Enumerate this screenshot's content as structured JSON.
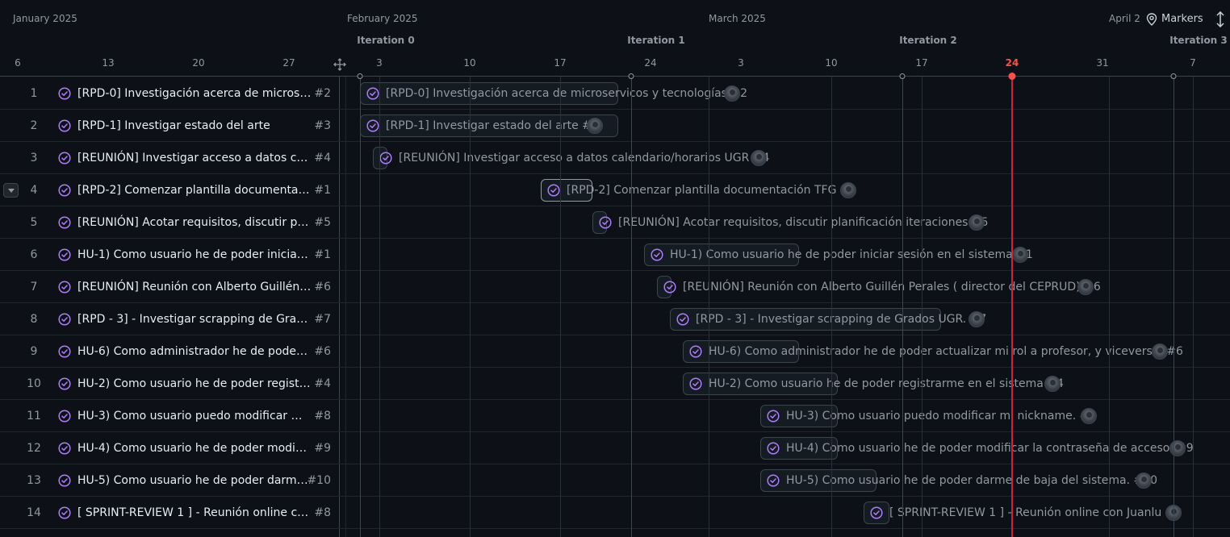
{
  "header": {
    "months": [
      "January 2025",
      "February 2025",
      "March 2025",
      "April 2"
    ],
    "iterations": [
      "Iteration 0",
      "Iteration 1",
      "Iteration 2",
      "Iteration 3"
    ],
    "days": [
      "6",
      "13",
      "20",
      "27",
      "3",
      "10",
      "17",
      "24",
      "3",
      "10",
      "17",
      "24",
      "31",
      "7"
    ],
    "today_label": "24",
    "markers_label": "Markers"
  },
  "colors": {
    "accent": "#ab7df8",
    "today": "#f85149",
    "background": "#0d1117"
  },
  "rows": [
    {
      "num": "1",
      "title": "[RPD-0] Investigación acerca de microservicos y tecnologías",
      "tag": "#2",
      "bar_label": "[RPD-0] Investigación acerca de microservicos y tecnologías #2"
    },
    {
      "num": "2",
      "title": "[RPD-1] Investigar estado del arte",
      "tag": "#3",
      "bar_label": "[RPD-1] Investigar estado del arte #3"
    },
    {
      "num": "3",
      "title": "[REUNIÓN] Investigar acceso a datos calendario/horarios UGR",
      "tag": "#4",
      "bar_label": "[REUNIÓN] Investigar acceso a datos calendario/horarios UGR #4"
    },
    {
      "num": "4",
      "title": "[RPD-2] Comenzar plantilla documentación TFG",
      "tag": "#1",
      "bar_label": "[RPD-2] Comenzar plantilla documentación TFG #1"
    },
    {
      "num": "5",
      "title": "[REUNIÓN] Acotar requisitos, discutir planificación iteraciones",
      "tag": "#5",
      "bar_label": "[REUNIÓN] Acotar requisitos, discutir planificación iteraciones #5"
    },
    {
      "num": "6",
      "title": "HU-1) Como usuario he de poder iniciar sesión en el sistema",
      "tag": "#1",
      "bar_label": "HU-1) Como usuario he de poder iniciar sesión en el sistema #1"
    },
    {
      "num": "7",
      "title": "[REUNIÓN] Reunión con Alberto Guillén Perales ( director del CEPRUD)",
      "tag": "#6",
      "bar_label": "[REUNIÓN] Reunión con Alberto Guillén Perales ( director del CEPRUD) #6"
    },
    {
      "num": "8",
      "title": "[RPD - 3] - Investigar scrapping de Grados UGR.",
      "tag": "#7",
      "bar_label": "[RPD - 3] - Investigar scrapping de Grados UGR. #7"
    },
    {
      "num": "9",
      "title": "HU-6) Como administrador he de poder actualizar mi rol a profesor, y viceversa.",
      "tag": "#6",
      "bar_label": "HU-6) Como administrador he de poder actualizar mi rol a profesor, y viceversa. #6"
    },
    {
      "num": "10",
      "title": "HU-2) Como usuario he de poder registrarme en el sistema",
      "tag": "#4",
      "bar_label": "HU-2) Como usuario he de poder registrarme en el sistema #4"
    },
    {
      "num": "11",
      "title": "HU-3) Como usuario puedo modificar mi nickname.",
      "tag": "#8",
      "bar_label": "HU-3) Como usuario puedo modificar mi nickname. #8"
    },
    {
      "num": "12",
      "title": "HU-4) Como usuario he de poder modificar la contraseña de acceso.",
      "tag": "#9",
      "bar_label": "HU-4) Como usuario he de poder modificar la contraseña de acceso. #9"
    },
    {
      "num": "13",
      "title": "HU-5) Como usuario he de poder darme de baja del sistema.",
      "tag": "#10",
      "bar_label": "HU-5) Como usuario he de poder darme de baja del sistema. #10"
    },
    {
      "num": "14",
      "title": "[ SPRINT-REVIEW 1 ] - Reunión online con Juanlu",
      "tag": "#8",
      "bar_label": "[ SPRINT-REVIEW 1 ] - Reunión online con Juanlu #8"
    }
  ]
}
